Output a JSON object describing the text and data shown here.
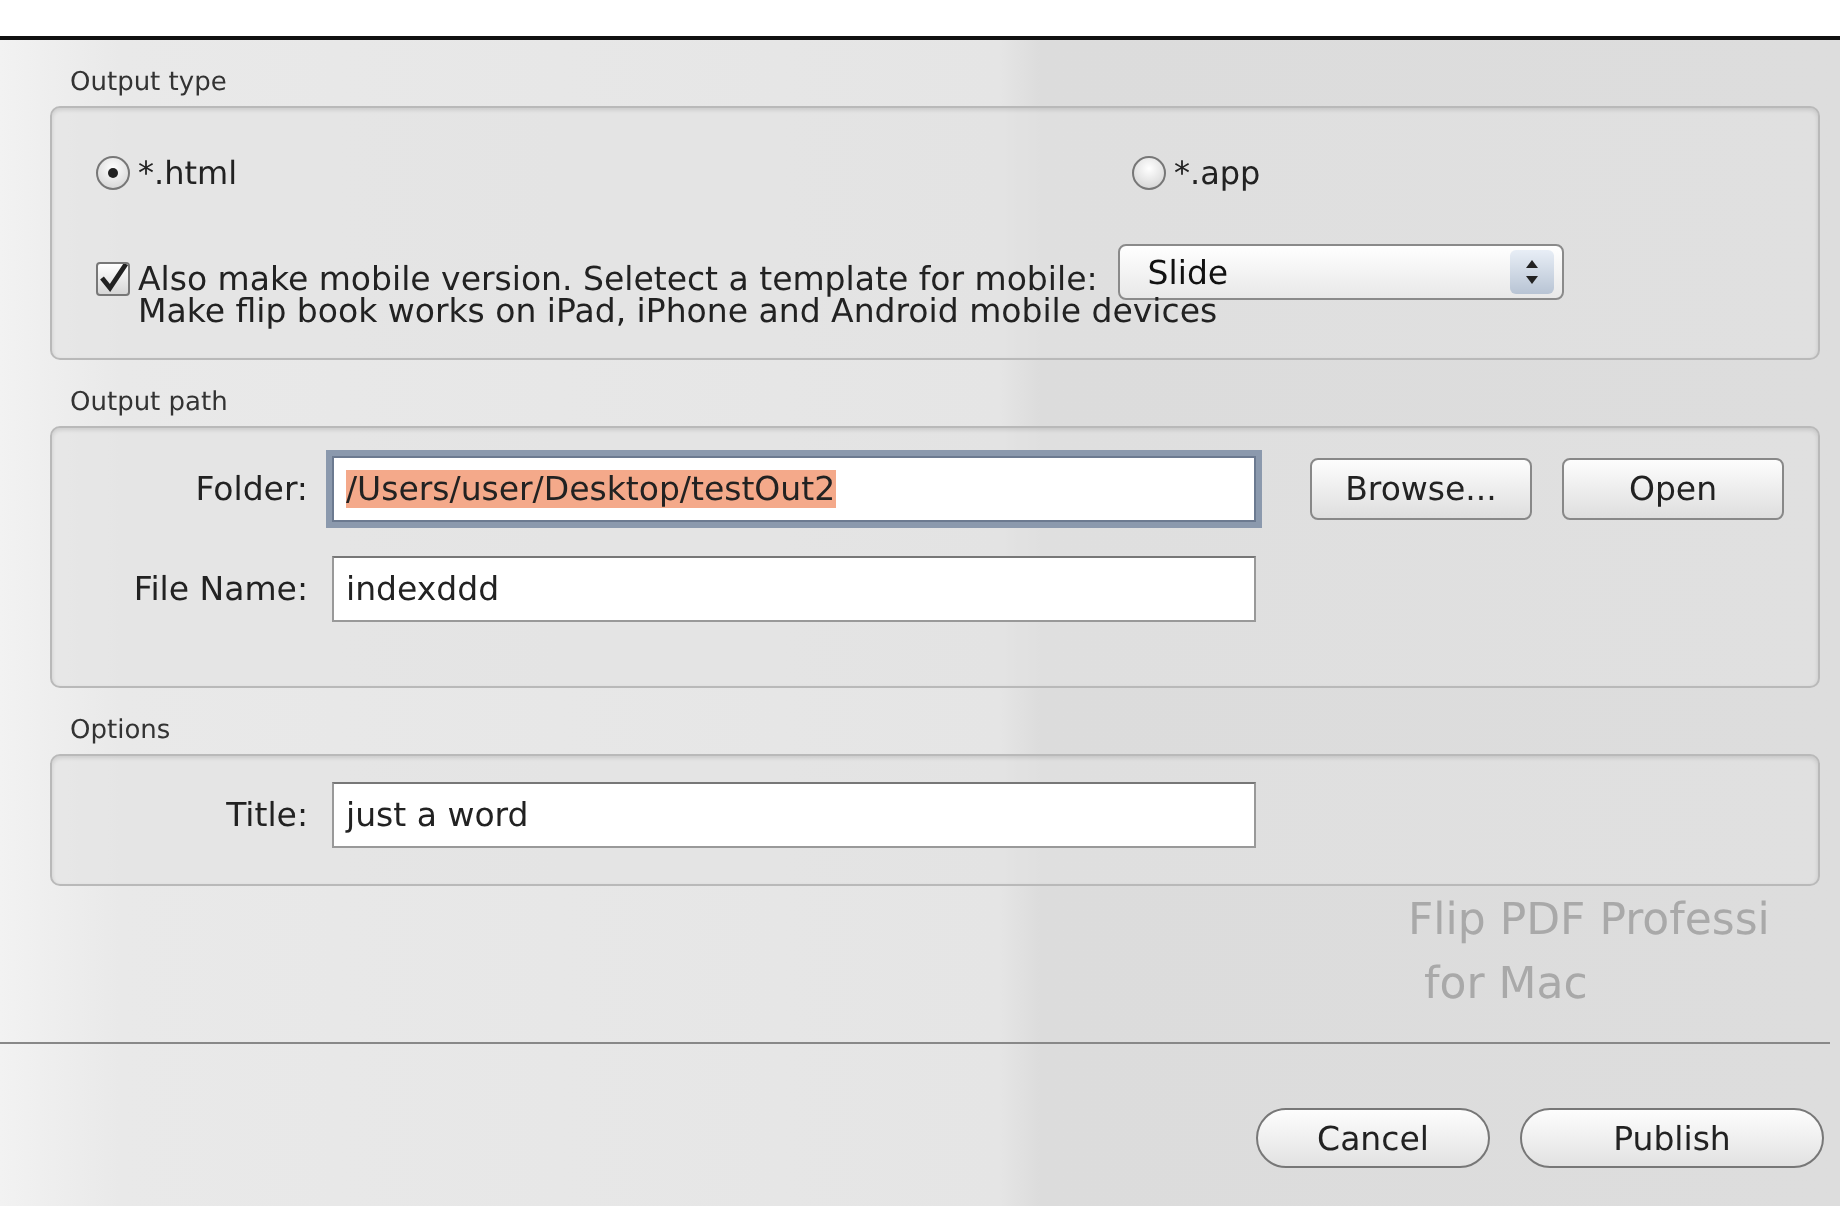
{
  "backdrop": {
    "lines": [
      "Flip PDF Professi",
      "for Mac"
    ]
  },
  "output_type": {
    "title": "Output type",
    "options": [
      {
        "label": "*.html",
        "selected": true
      },
      {
        "label": "*.app",
        "selected": false
      }
    ],
    "mobile": {
      "checked": true,
      "label": "Also make mobile version. Seletect a template for mobile:",
      "note": "Make flip book works on iPad, iPhone and Android mobile devices",
      "template": "Slide"
    }
  },
  "output_path": {
    "title": "Output path",
    "folder": {
      "label": "Folder:",
      "value": "/Users/user/Desktop/testOut2",
      "focused": true,
      "text_selected": true
    },
    "file_name": {
      "label": "File Name:",
      "value": "indexddd"
    },
    "buttons": [
      "Browse...",
      "Open"
    ]
  },
  "options": {
    "title": "Options",
    "title_field": {
      "label": "Title:",
      "value": "just a word"
    }
  },
  "buttons": [
    "Cancel",
    "Publish"
  ]
}
